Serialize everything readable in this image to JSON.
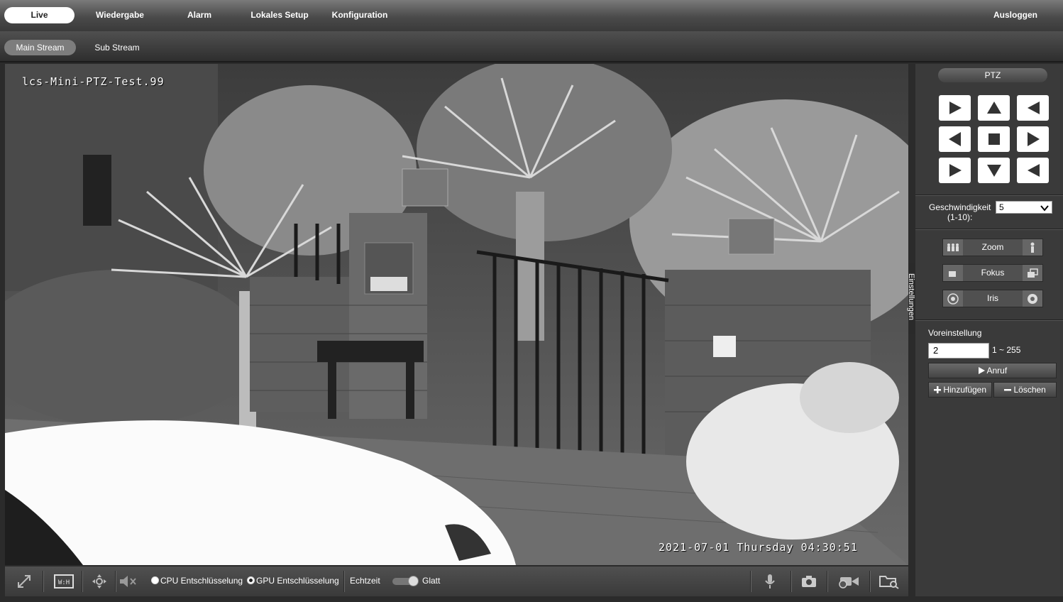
{
  "nav": {
    "items": [
      {
        "label": "Live",
        "active": true
      },
      {
        "label": "Wiedergabe"
      },
      {
        "label": "Alarm"
      },
      {
        "label": "Lokales Setup"
      },
      {
        "label": "Konfiguration"
      }
    ],
    "logout": "Ausloggen"
  },
  "streams": [
    {
      "label": "Main Stream",
      "active": true
    },
    {
      "label": "Sub Stream"
    }
  ],
  "video": {
    "osd_name": "lcs-Mini-PTZ-Test.99",
    "osd_datetime": "2021-07-01 Thursday 04:30:51"
  },
  "toolbar": {
    "icons": [
      "fullscreen-icon",
      "aspect-ratio-icon",
      "ptz-drag-icon",
      "mute-icon"
    ],
    "cpu_decoding": "CPU Entschlüsselung",
    "gpu_decoding": "GPU Entschlüsselung",
    "selected_decoding": "gpu",
    "realtime": "Echtzeit",
    "smooth": "Glatt",
    "right_icons": [
      "microphone-icon",
      "snapshot-icon",
      "record-icon",
      "folder-search-icon"
    ]
  },
  "side_tab": "Einstellungen",
  "ptz": {
    "title": "PTZ",
    "speed_label": "Geschwindigkeit",
    "speed_range": "(1-10):",
    "speed_value": "5",
    "zoom": "Zoom",
    "focus": "Fokus",
    "iris": "Iris",
    "preset_label": "Voreinstellung",
    "preset_value": "2",
    "preset_range": "1 ~ 255",
    "call": "Anruf",
    "add": "Hinzufügen",
    "delete": "Löschen"
  }
}
